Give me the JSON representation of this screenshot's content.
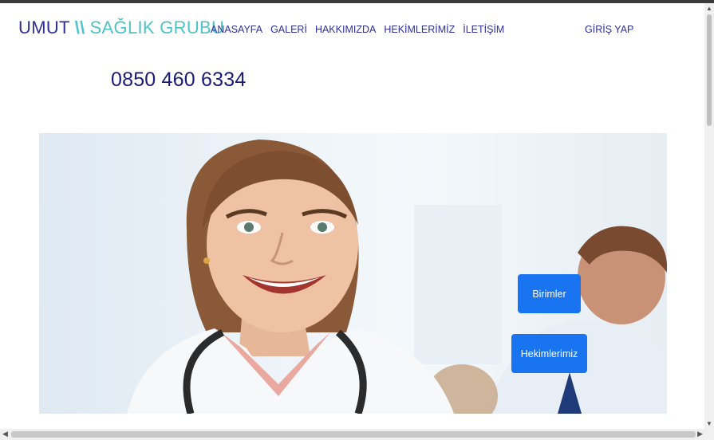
{
  "brand": {
    "part1": "UMUT",
    "separator": "\\\\",
    "part2": "SAĞLIK GRUBU"
  },
  "nav": {
    "items": [
      "ANASAYFA",
      "GALERİ",
      "HAKKIMIZDA",
      "HEKİMLERİMİZ",
      "İLETİŞİM"
    ],
    "login": "GİRİŞ YAP"
  },
  "contact": {
    "phone": "0850 460 6334"
  },
  "hero": {
    "buttons": {
      "units": "Birimler",
      "doctors": "Hekimlerimiz"
    }
  },
  "colors": {
    "brand_dark": "#2f2f9a",
    "brand_accent": "#4fc3c7",
    "button": "#1874f1"
  }
}
